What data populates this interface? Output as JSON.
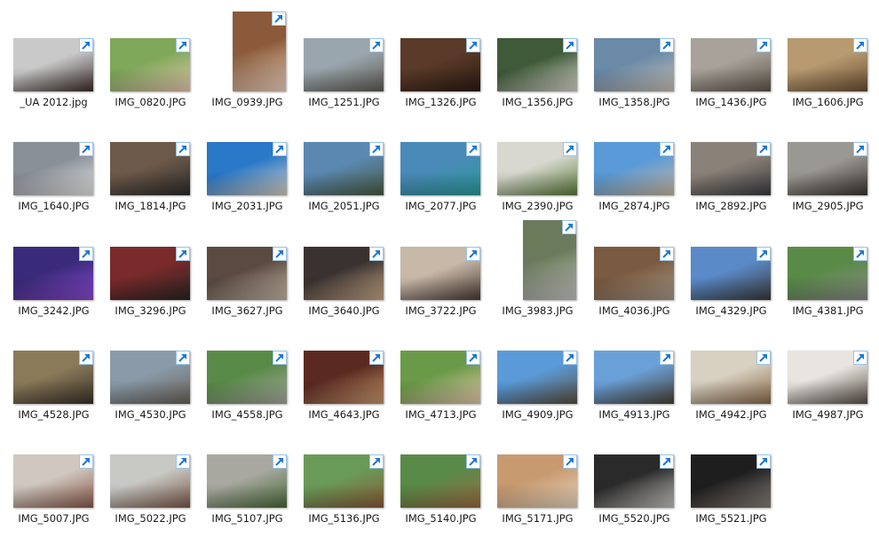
{
  "files": [
    {
      "name": "_UA 2012.jpg",
      "colors": [
        "#c9c9c9",
        "#3a2e2a"
      ],
      "orientation": "landscape"
    },
    {
      "name": "IMG_0820.JPG",
      "colors": [
        "#7fa85a",
        "#e8c8b0"
      ],
      "orientation": "landscape"
    },
    {
      "name": "IMG_0939.JPG",
      "colors": [
        "#8a5a3a",
        "#f1d5c0"
      ],
      "orientation": "portrait"
    },
    {
      "name": "IMG_1251.JPG",
      "colors": [
        "#9aa6ad",
        "#5f5a52"
      ],
      "orientation": "landscape"
    },
    {
      "name": "IMG_1326.JPG",
      "colors": [
        "#5a3a28",
        "#2a1a12"
      ],
      "orientation": "landscape"
    },
    {
      "name": "IMG_1356.JPG",
      "colors": [
        "#3f5a38",
        "#d8d4cc"
      ],
      "orientation": "landscape"
    },
    {
      "name": "IMG_1358.JPG",
      "colors": [
        "#6a8aa8",
        "#c9c1b5"
      ],
      "orientation": "landscape"
    },
    {
      "name": "IMG_1436.JPG",
      "colors": [
        "#a8a29a",
        "#5e554a"
      ],
      "orientation": "landscape"
    },
    {
      "name": "IMG_1606.JPG",
      "colors": [
        "#b89a70",
        "#6a4e34"
      ],
      "orientation": "landscape"
    },
    {
      "name": "IMG_1640.JPG",
      "colors": [
        "#8a9098",
        "#e8e8e6"
      ],
      "orientation": "landscape"
    },
    {
      "name": "IMG_1814.JPG",
      "colors": [
        "#6e5a4a",
        "#2a2a2a"
      ],
      "orientation": "landscape"
    },
    {
      "name": "IMG_2031.JPG",
      "colors": [
        "#2a78c8",
        "#d6cfc2"
      ],
      "orientation": "landscape"
    },
    {
      "name": "IMG_2051.JPG",
      "colors": [
        "#5a88b0",
        "#4a5a40"
      ],
      "orientation": "landscape"
    },
    {
      "name": "IMG_2077.JPG",
      "colors": [
        "#4a8ab8",
        "#2a9a9a"
      ],
      "orientation": "landscape"
    },
    {
      "name": "IMG_2390.JPG",
      "colors": [
        "#d8d8d0",
        "#5a7a3a"
      ],
      "orientation": "landscape"
    },
    {
      "name": "IMG_2874.JPG",
      "colors": [
        "#5a9ad8",
        "#c9b8a0"
      ],
      "orientation": "landscape"
    },
    {
      "name": "IMG_2892.JPG",
      "colors": [
        "#8a8278",
        "#3a3a40"
      ],
      "orientation": "landscape"
    },
    {
      "name": "IMG_2905.JPG",
      "colors": [
        "#9a9892",
        "#3a3430"
      ],
      "orientation": "landscape"
    },
    {
      "name": "IMG_3242.JPG",
      "colors": [
        "#3a2a7a",
        "#8a4ad0"
      ],
      "orientation": "landscape"
    },
    {
      "name": "IMG_3296.JPG",
      "colors": [
        "#7a2a2a",
        "#2a2424"
      ],
      "orientation": "landscape"
    },
    {
      "name": "IMG_3627.JPG",
      "colors": [
        "#5a4a40",
        "#c8b8a8"
      ],
      "orientation": "landscape"
    },
    {
      "name": "IMG_3640.JPG",
      "colors": [
        "#3a3230",
        "#c8a888"
      ],
      "orientation": "landscape"
    },
    {
      "name": "IMG_3722.JPG",
      "colors": [
        "#c8b8a8",
        "#4a3a34"
      ],
      "orientation": "landscape"
    },
    {
      "name": "IMG_3983.JPG",
      "colors": [
        "#6a7a5a",
        "#c8c8c8"
      ],
      "orientation": "portrait"
    },
    {
      "name": "IMG_4036.JPG",
      "colors": [
        "#7a5a40",
        "#a89a88"
      ],
      "orientation": "landscape"
    },
    {
      "name": "IMG_4329.JPG",
      "colors": [
        "#5a8ac8",
        "#3a3a3a"
      ],
      "orientation": "landscape"
    },
    {
      "name": "IMG_4381.JPG",
      "colors": [
        "#5a8a48",
        "#8a8a88"
      ],
      "orientation": "landscape"
    },
    {
      "name": "IMG_4528.JPG",
      "colors": [
        "#8a7a5a",
        "#3a3028"
      ],
      "orientation": "landscape"
    },
    {
      "name": "IMG_4530.JPG",
      "colors": [
        "#8a9aa8",
        "#6a6258"
      ],
      "orientation": "landscape"
    },
    {
      "name": "IMG_4558.JPG",
      "colors": [
        "#5a8a48",
        "#a8a8a0"
      ],
      "orientation": "landscape"
    },
    {
      "name": "IMG_4643.JPG",
      "colors": [
        "#5a2a20",
        "#c89a70"
      ],
      "orientation": "landscape"
    },
    {
      "name": "IMG_4713.JPG",
      "colors": [
        "#6a9a48",
        "#e8c8b0"
      ],
      "orientation": "landscape"
    },
    {
      "name": "IMG_4909.JPG",
      "colors": [
        "#5a9ad8",
        "#5a4e40"
      ],
      "orientation": "landscape"
    },
    {
      "name": "IMG_4913.JPG",
      "colors": [
        "#6aa0d8",
        "#4a4034"
      ],
      "orientation": "landscape"
    },
    {
      "name": "IMG_4942.JPG",
      "colors": [
        "#d8d0c0",
        "#8a6a4a"
      ],
      "orientation": "landscape"
    },
    {
      "name": "IMG_4987.JPG",
      "colors": [
        "#e8e4e0",
        "#5a5048"
      ],
      "orientation": "landscape"
    },
    {
      "name": "IMG_5007.JPG",
      "colors": [
        "#d0c8c0",
        "#8a5a4a"
      ],
      "orientation": "landscape"
    },
    {
      "name": "IMG_5022.JPG",
      "colors": [
        "#c8c8c4",
        "#7a5a48"
      ],
      "orientation": "landscape"
    },
    {
      "name": "IMG_5107.JPG",
      "colors": [
        "#a8a8a0",
        "#4a6a38"
      ],
      "orientation": "landscape"
    },
    {
      "name": "IMG_5136.JPG",
      "colors": [
        "#6a9a58",
        "#8a5a38"
      ],
      "orientation": "landscape"
    },
    {
      "name": "IMG_5140.JPG",
      "colors": [
        "#5a8a48",
        "#9a6a40"
      ],
      "orientation": "landscape"
    },
    {
      "name": "IMG_5171.JPG",
      "colors": [
        "#c89a70",
        "#e8d8c0"
      ],
      "orientation": "landscape"
    },
    {
      "name": "IMG_5520.JPG",
      "colors": [
        "#2a2a2a",
        "#c8c4c0"
      ],
      "orientation": "landscape"
    },
    {
      "name": "IMG_5521.JPG",
      "colors": [
        "#1e1e1e",
        "#8a8078"
      ],
      "orientation": "landscape"
    }
  ],
  "shortcut_icon": "shortcut-arrow-icon",
  "accent_color": "#1e78d2"
}
